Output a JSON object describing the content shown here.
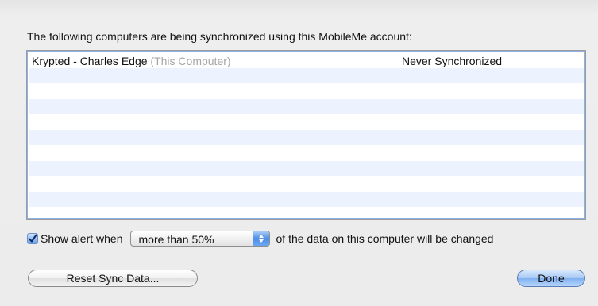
{
  "heading": "The following computers are being synchronized using this MobileMe account:",
  "computers": [
    {
      "name": "Krypted - Charles Edge",
      "hint": "(This Computer)",
      "status": "Never Synchronized"
    }
  ],
  "alert": {
    "checked": true,
    "label_before": "Show alert when",
    "selected_option": "more than 50%",
    "label_after": "of the data on this computer will be changed"
  },
  "buttons": {
    "reset": "Reset Sync Data...",
    "done": "Done"
  },
  "colors": {
    "list_stripe": "#edf3fe",
    "focus_ring": "#8ab2e6",
    "accent_blue": "#4d8ee6"
  },
  "icons": {
    "checkbox": "checkmark-icon",
    "popup": "up-down-arrows-icon"
  }
}
